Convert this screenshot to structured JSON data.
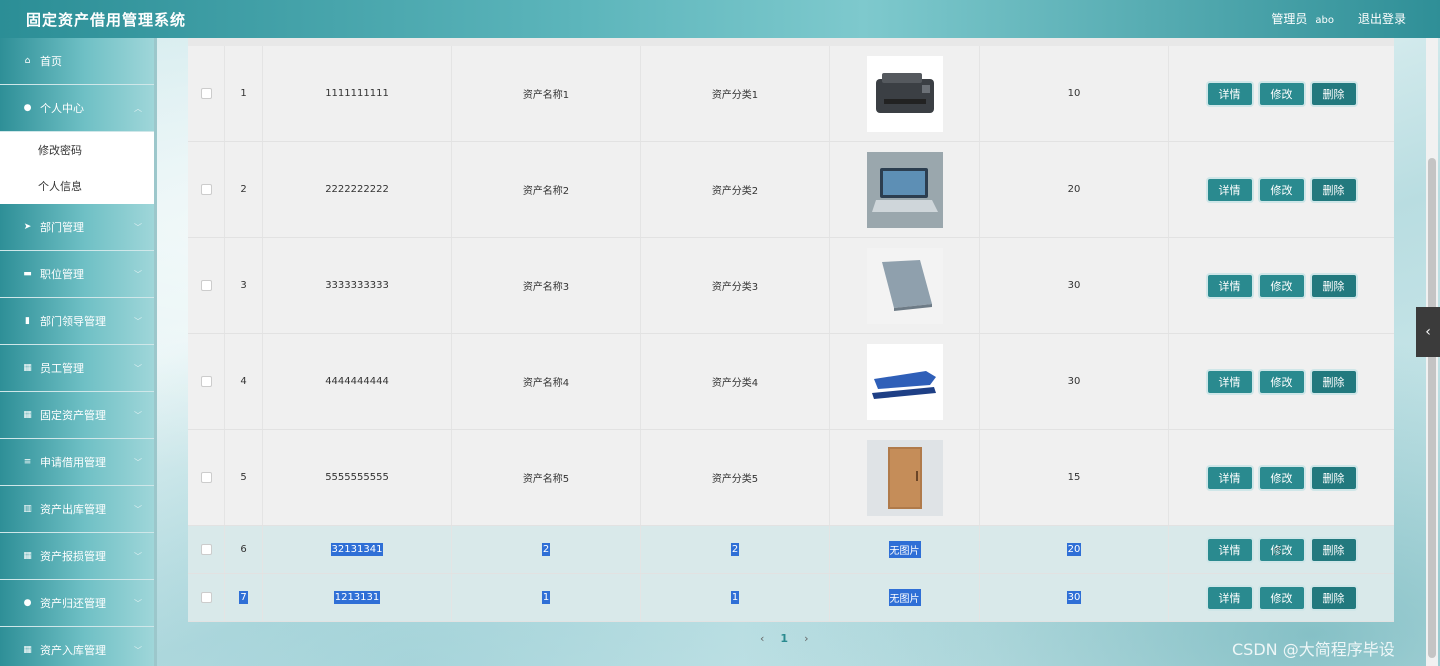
{
  "app": {
    "title": "固定资产借用管理系统"
  },
  "user": {
    "role": "管理员",
    "name": "abo",
    "logout": "退出登录"
  },
  "sidebar": {
    "items": [
      {
        "label": "首页",
        "icon": "home-icon",
        "glyph": "⌂"
      },
      {
        "label": "个人中心",
        "icon": "user-icon",
        "glyph": "●",
        "expanded": true,
        "children": [
          "修改密码",
          "个人信息"
        ]
      },
      {
        "label": "部门管理",
        "icon": "send-icon",
        "glyph": "➤"
      },
      {
        "label": "职位管理",
        "icon": "monitor-icon",
        "glyph": "▬"
      },
      {
        "label": "部门领导管理",
        "icon": "clipboard-icon",
        "glyph": "▮"
      },
      {
        "label": "员工管理",
        "icon": "grid-icon",
        "glyph": "▦"
      },
      {
        "label": "固定资产管理",
        "icon": "grid-icon",
        "glyph": "▦"
      },
      {
        "label": "申请借用管理",
        "icon": "list-icon",
        "glyph": "≡"
      },
      {
        "label": "资产出库管理",
        "icon": "chart-icon",
        "glyph": "▥"
      },
      {
        "label": "资产报损管理",
        "icon": "grid-icon",
        "glyph": "▦"
      },
      {
        "label": "资产归还管理",
        "icon": "pin-icon",
        "glyph": "●"
      },
      {
        "label": "资产入库管理",
        "icon": "grid-icon",
        "glyph": "▦"
      }
    ]
  },
  "table": {
    "buttons": {
      "detail": "详情",
      "edit": "修改",
      "delete": "删除"
    },
    "rows": [
      {
        "index": "1",
        "code": "1111111111",
        "name": "资产名称1",
        "category": "资产分类1",
        "image": "printer",
        "qty": "10"
      },
      {
        "index": "2",
        "code": "2222222222",
        "name": "资产名称2",
        "category": "资产分类2",
        "image": "laptop-open",
        "qty": "20"
      },
      {
        "index": "3",
        "code": "3333333333",
        "name": "资产名称3",
        "category": "资产分类3",
        "image": "laptop-closed",
        "qty": "30"
      },
      {
        "index": "4",
        "code": "4444444444",
        "name": "资产名称4",
        "category": "资产分类4",
        "image": "stapler",
        "qty": "30"
      },
      {
        "index": "5",
        "code": "5555555555",
        "name": "资产名称5",
        "category": "资产分类5",
        "image": "cabinet",
        "qty": "15"
      },
      {
        "index": "6",
        "code": "32131341",
        "name": "2",
        "category": "2",
        "image": "无图片",
        "qty": "20"
      },
      {
        "index": "7",
        "code": "1213131",
        "name": "1",
        "category": "1",
        "image": "无图片",
        "qty": "30"
      }
    ]
  },
  "pager": {
    "prev": "‹",
    "current": "1",
    "next": "›"
  },
  "watermark": "CSDN @大简程序毕设",
  "colors": {
    "accent": "#2a8a8f",
    "selection": "#2f6fd6"
  }
}
